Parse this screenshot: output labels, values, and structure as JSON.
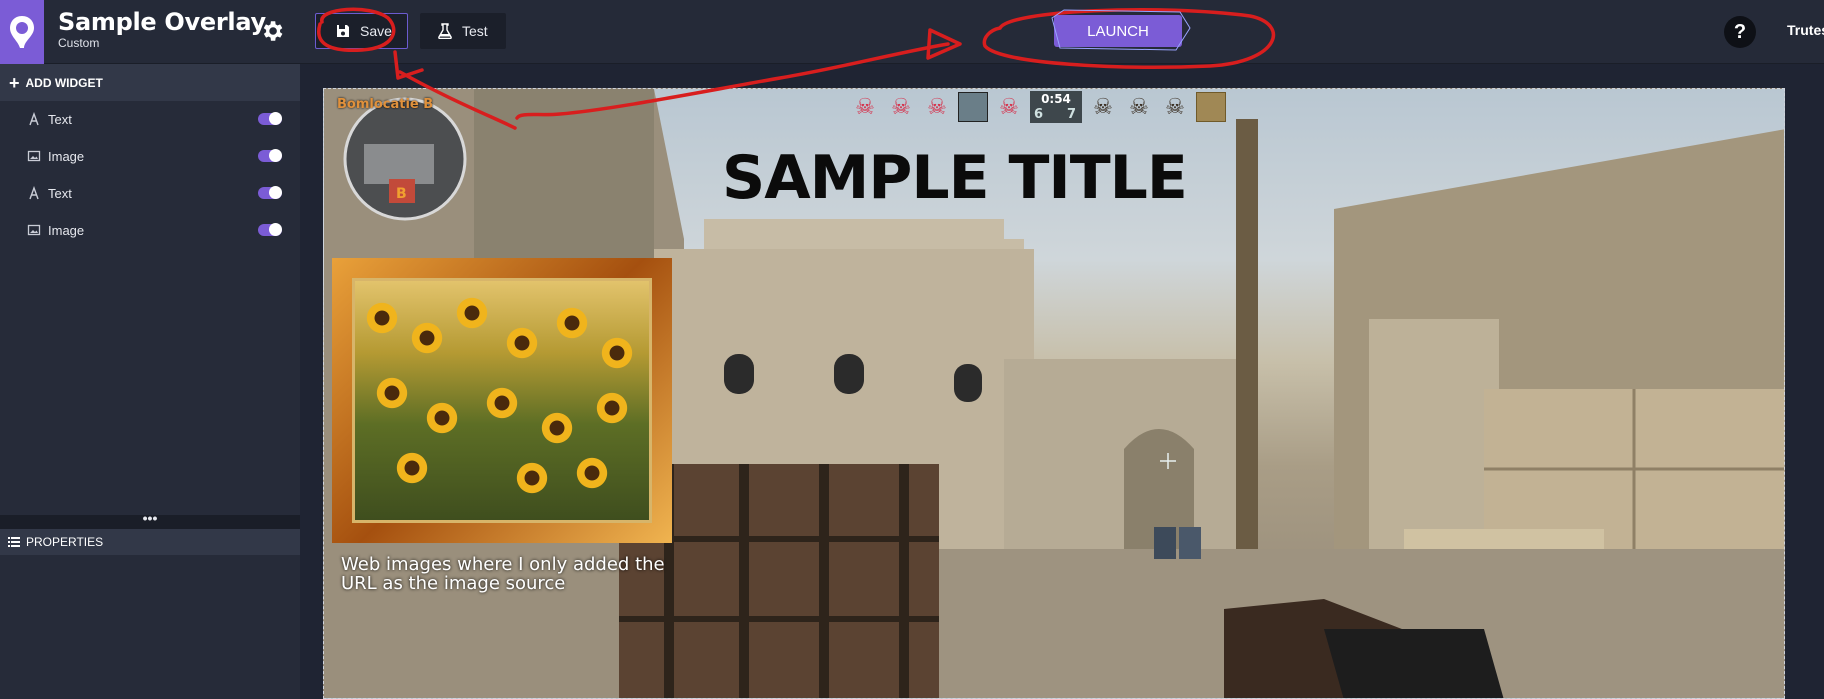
{
  "app": {
    "title": "Sample Overlay",
    "subtitle": "Custom"
  },
  "toolbar": {
    "save_label": "Save",
    "test_label": "Test",
    "launch_label": "LAUNCH",
    "help_label": "?",
    "user_label": "Trutes"
  },
  "sidebar": {
    "add_widget_label": "ADD WIDGET",
    "widgets": [
      {
        "label": "Text",
        "icon": "text-icon",
        "enabled": true
      },
      {
        "label": "Image",
        "icon": "image-icon",
        "enabled": true
      },
      {
        "label": "Text",
        "icon": "text-icon",
        "enabled": true
      },
      {
        "label": "Image",
        "icon": "image-icon",
        "enabled": true
      }
    ],
    "resize_handle": "•••",
    "properties_label": "PROPERTIES"
  },
  "canvas": {
    "bomb_site_label": "Bomlocatie B",
    "hud": {
      "timer": "0:54",
      "score_left": "6",
      "score_right": "7"
    },
    "title_text": "SAMPLE TITLE",
    "caption_text": "Web images where I only added the URL as the image source"
  },
  "colors": {
    "accent": "#7b5cd6",
    "annotation": "#d81e1e",
    "topbar": "#252a38",
    "sidebar": "#262b39"
  }
}
